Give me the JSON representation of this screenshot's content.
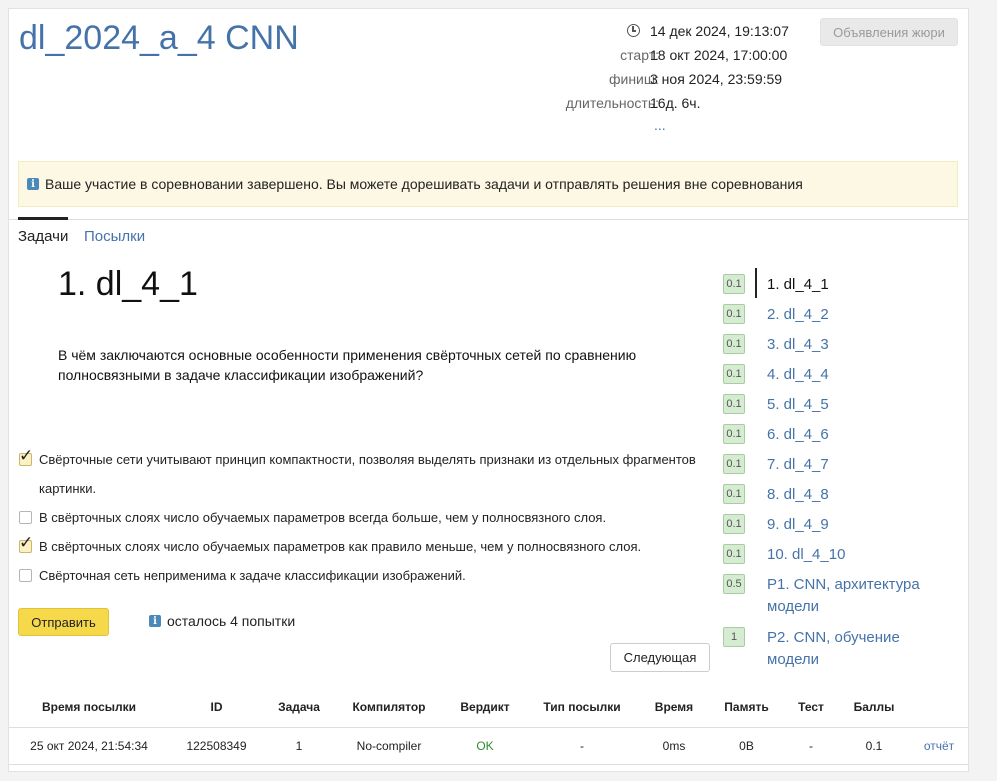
{
  "contest": {
    "title": "dl_2024_a_4 CNN",
    "current_time": "14 дек 2024, 19:13:07",
    "start_label": "старт:",
    "start_value": "18 окт 2024, 17:00:00",
    "finish_label": "финиш:",
    "finish_value": "3 ноя 2024, 23:59:59",
    "duration_label": "длительность:",
    "duration_value": "16д. 6ч.",
    "more": "...",
    "jury_button": "Объявления жюри"
  },
  "notice": {
    "icon": "info-icon",
    "text": "Ваше участие в соревновании завершено. Вы можете дорешивать задачи и отправлять решения вне соревнования"
  },
  "tabs": [
    {
      "label": "Задачи",
      "active": true
    },
    {
      "label": "Посылки",
      "active": false
    }
  ],
  "problem": {
    "title": "1. dl_4_1",
    "question": "В чём заключаются основные особенности применения свёрточных сетей по сравнению полносвязными в задаче классификации изображений?",
    "answers": [
      {
        "text": "Свёрточные сети учитывают принцип компактности, позволяя выделять признаки из отдельных фрагментов картинки.",
        "checked": true
      },
      {
        "text": "В свёрточных слоях число обучаемых параметров всегда больше, чем у полносвязного слоя.",
        "checked": false
      },
      {
        "text": "В свёрточных слоях число обучаемых параметров как правило меньше, чем у полносвязного слоя.",
        "checked": true
      },
      {
        "text": "Свёрточная сеть неприменима к задаче классификации изображений.",
        "checked": false
      }
    ],
    "submit_label": "Отправить",
    "attempts_text": "осталось 4 попытки",
    "next_label": "Следующая"
  },
  "problem_list": [
    {
      "score": "0.1",
      "label": "1. dl_4_1",
      "current": true
    },
    {
      "score": "0.1",
      "label": "2. dl_4_2"
    },
    {
      "score": "0.1",
      "label": "3. dl_4_3"
    },
    {
      "score": "0.1",
      "label": "4. dl_4_4"
    },
    {
      "score": "0.1",
      "label": "5. dl_4_5"
    },
    {
      "score": "0.1",
      "label": "6. dl_4_6"
    },
    {
      "score": "0.1",
      "label": "7. dl_4_7"
    },
    {
      "score": "0.1",
      "label": "8. dl_4_8"
    },
    {
      "score": "0.1",
      "label": "9. dl_4_9"
    },
    {
      "score": "0.1",
      "label": "10. dl_4_10"
    },
    {
      "score": "0.5",
      "label": "P1. CNN, архитектура модели"
    },
    {
      "score": "1",
      "label": "P2. CNN, обучение модели"
    }
  ],
  "submissions": {
    "columns": [
      "Время посылки",
      "ID",
      "Задача",
      "Компилятор",
      "Вердикт",
      "Тип посылки",
      "Время",
      "Память",
      "Тест",
      "Баллы"
    ],
    "rows": [
      {
        "time": "25 окт 2024, 21:54:34",
        "id": "122508349",
        "task": "1",
        "compiler": "No-compiler",
        "verdict": "OK",
        "type": "-",
        "duration": "0ms",
        "memory": "0B",
        "test": "-",
        "score": "0.1",
        "report": "отчёт"
      }
    ]
  },
  "colors": {
    "accent": "#4573a9",
    "warning_bg": "#fcf8e3",
    "submit": "#f6d94a",
    "ok": "#2f8c2f",
    "badge": "#d6ecd2"
  }
}
